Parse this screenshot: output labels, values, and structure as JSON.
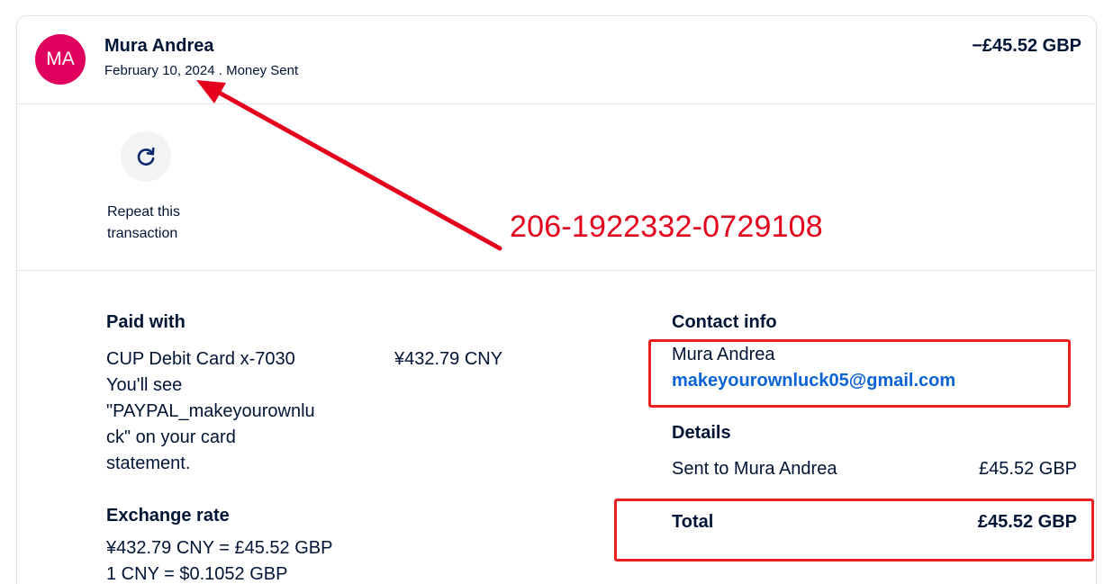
{
  "header": {
    "avatar_initials": "MA",
    "name": "Mura Andrea",
    "date_type": "February 10, 2024 . Money Sent",
    "amount": "−£45.52 GBP"
  },
  "actions": {
    "repeat_label_line1": "Repeat this",
    "repeat_label_line2": "transaction"
  },
  "paid_with": {
    "title": "Paid with",
    "card": "CUP Debit Card x-7030",
    "amount": "¥432.79 CNY",
    "note_line1": "You'll see",
    "note_line2": "\"PAYPAL_makeyourownlu",
    "note_line3": "ck\" on your card",
    "note_line4": "statement."
  },
  "exchange": {
    "title": "Exchange rate",
    "line1": "¥432.79 CNY = £45.52 GBP",
    "line2": "1 CNY = $0.1052 GBP"
  },
  "contact": {
    "title": "Contact info",
    "name": "Mura Andrea",
    "email": "makeyourownluck05@gmail.com"
  },
  "details": {
    "title": "Details",
    "sent_to_label": "Sent to Mura Andrea",
    "sent_to_amount": "£45.52 GBP",
    "total_label": "Total",
    "total_amount": "£45.52 GBP"
  },
  "annotation": {
    "transaction_id": "206-1922332-0729108",
    "color": "#e4001c"
  },
  "colors": {
    "text": "#001435",
    "avatar_bg": "#e0005e",
    "link": "#0b63d6"
  }
}
